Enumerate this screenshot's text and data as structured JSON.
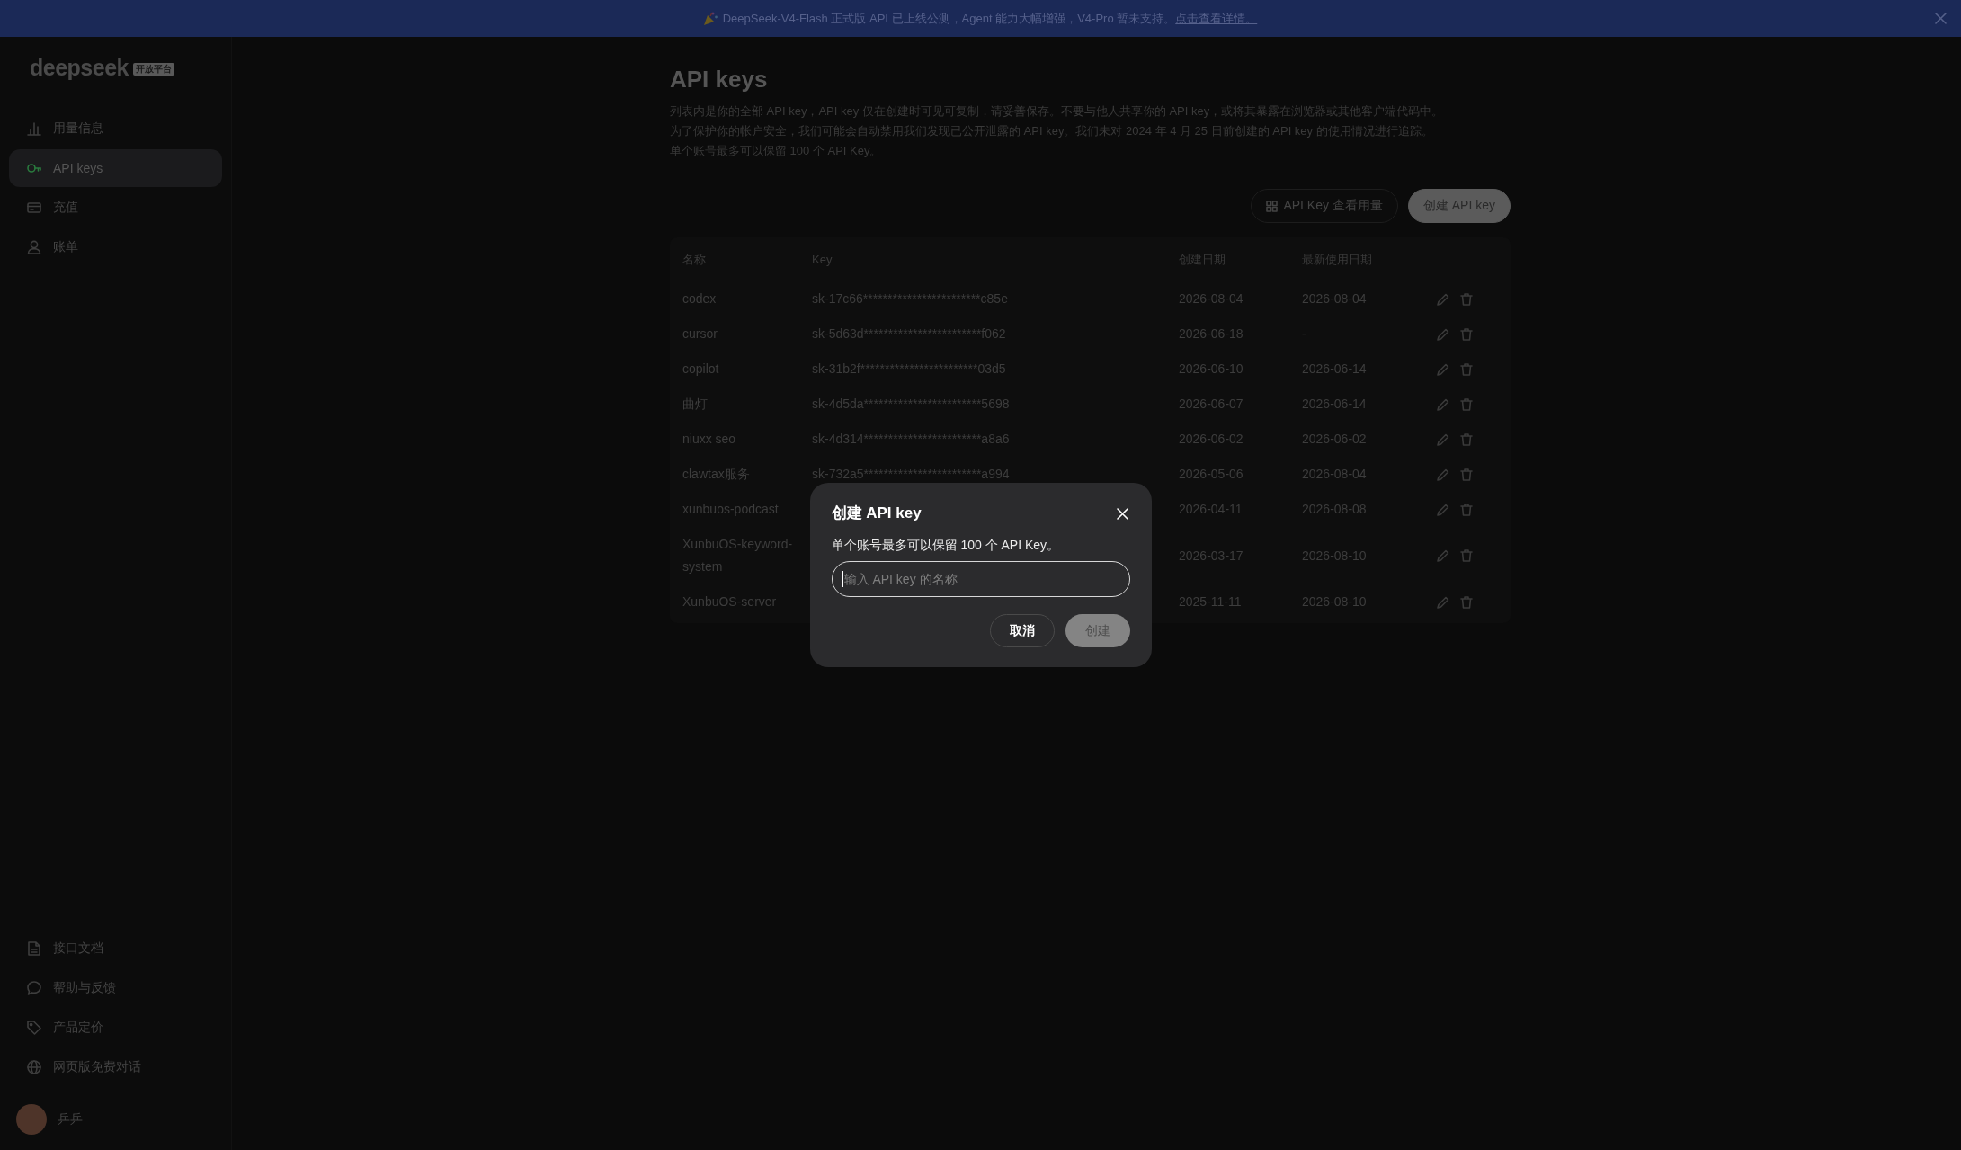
{
  "banner": {
    "text": "DeepSeek-V4-Flash 正式版 API 已上线公测，Agent 能力大幅增强，V4-Pro 暂未支持。",
    "link": "点击查看详情。"
  },
  "sidebar": {
    "logo": {
      "wordmark": "deepseek",
      "badge": "开放平台"
    },
    "nav": [
      {
        "label": "用量信息",
        "selected": false
      },
      {
        "label": "API keys",
        "selected": true
      },
      {
        "label": "充值",
        "selected": false
      },
      {
        "label": "账单",
        "selected": false
      }
    ],
    "links": [
      {
        "label": "接口文档"
      },
      {
        "label": "帮助与反馈"
      },
      {
        "label": "产品定价"
      },
      {
        "label": "网页版免费对话"
      }
    ],
    "user": {
      "name": "乒乒"
    }
  },
  "page": {
    "title": "API keys",
    "description": [
      "列表内是你的全部 API key，API key 仅在创建时可见可复制，请妥善保存。不要与他人共享你的 API key，或将其暴露在浏览器或其他客户端代码中。",
      "为了保护你的帐户安全，我们可能会自动禁用我们发现已公开泄露的 API key。我们未对 2024 年 4 月 25 日前创建的 API key 的使用情况进行追踪。",
      "单个账号最多可以保留 100 个 API Key。"
    ],
    "actions": [
      {
        "label": "API Key 查看用量",
        "kind": "secondary"
      },
      {
        "label": "创建 API key",
        "kind": "primary"
      }
    ]
  },
  "table": {
    "columns": [
      "名称",
      "Key",
      "创建日期",
      "最新使用日期"
    ],
    "rows": [
      {
        "name": "codex",
        "key": "sk-17c66************************c85e",
        "created": "2026-08-04",
        "last_used": "2026-08-04"
      },
      {
        "name": "cursor",
        "key": "sk-5d63d************************f062",
        "created": "2026-06-18",
        "last_used": "-"
      },
      {
        "name": "copilot",
        "key": "sk-31b2f************************03d5",
        "created": "2026-06-10",
        "last_used": "2026-06-14"
      },
      {
        "name": "曲灯",
        "key": "sk-4d5da************************5698",
        "created": "2026-06-07",
        "last_used": "2026-06-14"
      },
      {
        "name": "niuxx seo",
        "key": "sk-4d314************************a8a6",
        "created": "2026-06-02",
        "last_used": "2026-06-02"
      },
      {
        "name": "clawtax服务",
        "key": "sk-732a5************************a994",
        "created": "2026-05-06",
        "last_used": "2026-08-04"
      },
      {
        "name": "xunbuos-podcast",
        "created": "2026-04-11",
        "last_used": "2026-08-08"
      },
      {
        "name": "XunbuOS-keyword-system",
        "created": "2026-03-17",
        "last_used": "2026-08-10"
      },
      {
        "name": "XunbuOS-server",
        "created": "2025-11-11",
        "last_used": "2026-08-10"
      }
    ]
  },
  "dialog": {
    "title": "创建 API key",
    "note": "单个账号最多可以保留 100 个 API Key。",
    "input": {
      "placeholder": "输入 API key 的名称",
      "focused": true
    },
    "buttons": [
      {
        "label": "取消",
        "kind": "secondary",
        "disabled": false
      },
      {
        "label": "创建",
        "kind": "primary",
        "disabled": true
      }
    ]
  }
}
